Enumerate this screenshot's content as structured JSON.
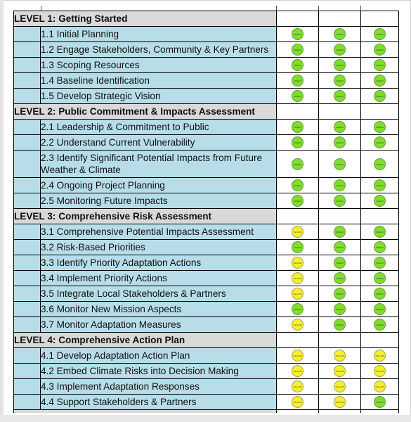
{
  "colors": {
    "green": "#7ede2a",
    "yellow": "#f6ef2b",
    "level_header_bg": "#d9d9d9",
    "item_bg": "#b7dde8"
  },
  "status_labels": {
    "green": "GREEN",
    "yellow": "YELLOW"
  },
  "levels": [
    {
      "title": "LEVEL 1:  Getting Started",
      "items": [
        {
          "label": "1.1 Initial Planning",
          "status": [
            "green",
            "green",
            "green"
          ]
        },
        {
          "label": "1.2 Engage Stakeholders, Community & Key Partners",
          "status": [
            "green",
            "green",
            "green"
          ]
        },
        {
          "label": "1.3 Scoping Resources",
          "status": [
            "green",
            "green",
            "green"
          ]
        },
        {
          "label": "1.4 Baseline Identification",
          "status": [
            "green",
            "green",
            "green"
          ]
        },
        {
          "label": "1.5 Develop Strategic Vision",
          "status": [
            "green",
            "green",
            "green"
          ]
        }
      ]
    },
    {
      "title": "LEVEL 2:  Public Commitment & Impacts Assessment",
      "items": [
        {
          "label": "2.1 Leadership & Commitment to Public",
          "status": [
            "green",
            "green",
            "green"
          ]
        },
        {
          "label": "2.2 Understand Current Vulnerability",
          "status": [
            "green",
            "green",
            "green"
          ]
        },
        {
          "label": "2.3 Identify Significant Potential Impacts from Future Weather & Climate",
          "status": [
            "green",
            "green",
            "green"
          ],
          "wrap": true
        },
        {
          "label": "2.4 Ongoing Project Planning",
          "status": [
            "green",
            "green",
            "green"
          ]
        },
        {
          "label": "2.5 Monitoring Future Impacts",
          "status": [
            "green",
            "green",
            "green"
          ]
        }
      ]
    },
    {
      "title": "LEVEL 3:  Comprehensive Risk Assessment",
      "items": [
        {
          "label": "3.1 Comprehensive Potential Impacts Assessment",
          "status": [
            "yellow",
            "green",
            "green"
          ]
        },
        {
          "label": "3.2 Risk-Based Priorities",
          "status": [
            "green",
            "green",
            "green"
          ]
        },
        {
          "label": "3.3 Identify Priority Adaptation Actions",
          "status": [
            "yellow",
            "green",
            "green"
          ]
        },
        {
          "label": "3.4 Implement Priority Actions",
          "status": [
            "yellow",
            "green",
            "green"
          ]
        },
        {
          "label": "3.5 Integrate Local Stakeholders & Partners",
          "status": [
            "yellow",
            "green",
            "green"
          ]
        },
        {
          "label": "3.6 Monitor New Mission Aspects",
          "status": [
            "green",
            "green",
            "green"
          ]
        },
        {
          "label": "3.7 Monitor Adaptation Measures",
          "status": [
            "yellow",
            "green",
            "green"
          ]
        }
      ]
    },
    {
      "title": "LEVEL 4:  Comprehensive Action Plan",
      "items": [
        {
          "label": "4.1 Develop Adaptation Action Plan",
          "status": [
            "yellow",
            "yellow",
            "yellow"
          ]
        },
        {
          "label": "4.2 Embed Climate Risks into Decision Making",
          "status": [
            "yellow",
            "yellow",
            "yellow"
          ]
        },
        {
          "label": "4.3 Implement Adaptation Responses",
          "status": [
            "yellow",
            "yellow",
            "yellow"
          ]
        },
        {
          "label": "4.4 Support Stakeholders & Partners",
          "status": [
            "yellow",
            "yellow",
            "green"
          ]
        }
      ]
    }
  ]
}
